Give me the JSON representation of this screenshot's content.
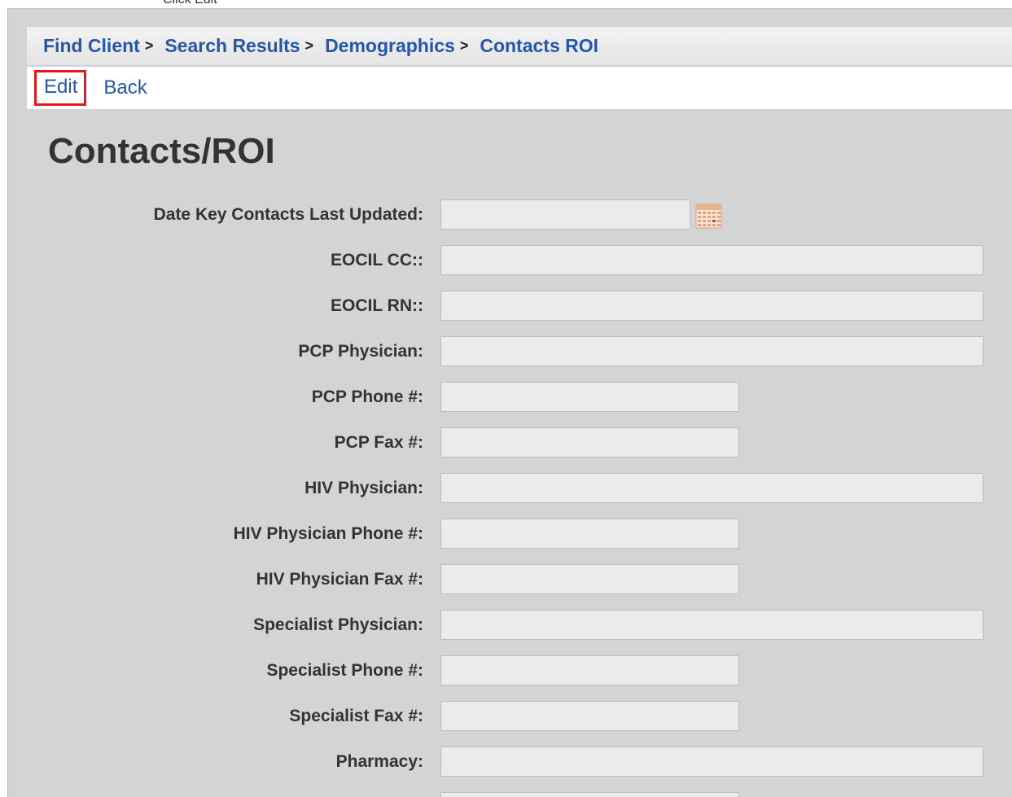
{
  "caption": "Click Edit",
  "breadcrumb": [
    {
      "label": "Find Client",
      "sep": ">"
    },
    {
      "label": "Search Results",
      "sep": ">"
    },
    {
      "label": "Demographics",
      "sep": ">"
    },
    {
      "label": "Contacts ROI",
      "sep": ""
    }
  ],
  "actions": {
    "edit_label": "Edit",
    "back_label": "Back"
  },
  "page_title": "Contacts/ROI",
  "fields": [
    {
      "label": "Date Key Contacts Last Updated:",
      "value": "",
      "width": "date",
      "icon": "calendar-icon"
    },
    {
      "label": "EOCIL CC::",
      "value": "",
      "width": "long"
    },
    {
      "label": "EOCIL RN::",
      "value": "",
      "width": "long"
    },
    {
      "label": "PCP Physician:",
      "value": "",
      "width": "long"
    },
    {
      "label": "PCP Phone #:",
      "value": "",
      "width": "short"
    },
    {
      "label": "PCP Fax #:",
      "value": "",
      "width": "short"
    },
    {
      "label": "HIV Physician:",
      "value": "",
      "width": "long"
    },
    {
      "label": "HIV Physician Phone #:",
      "value": "",
      "width": "short"
    },
    {
      "label": "HIV Physician Fax #:",
      "value": "",
      "width": "short"
    },
    {
      "label": "Specialist Physician:",
      "value": "",
      "width": "long"
    },
    {
      "label": "Specialist Phone #:",
      "value": "",
      "width": "short"
    },
    {
      "label": "Specialist Fax #:",
      "value": "",
      "width": "short"
    },
    {
      "label": "Pharmacy:",
      "value": "",
      "width": "long"
    },
    {
      "label": "",
      "value": "",
      "width": "short"
    }
  ],
  "colors": {
    "link": "#2657a6",
    "highlight": "#e8161d",
    "panel": "#d4d4d4"
  }
}
